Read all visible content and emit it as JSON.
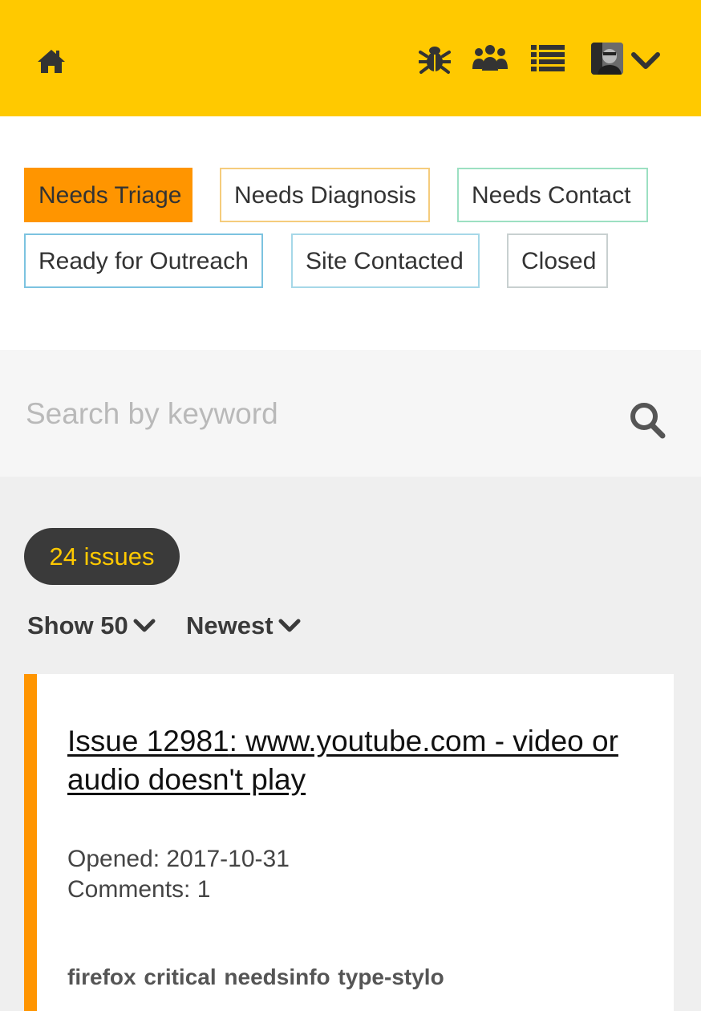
{
  "header": {
    "icons": [
      "home-icon",
      "bug-icon",
      "people-icon",
      "list-icon",
      "avatar",
      "chevron-down-icon"
    ],
    "background": "#ffc900"
  },
  "labels": [
    {
      "text": "Needs Triage",
      "color": "#ff9500",
      "active": true
    },
    {
      "text": "Needs Diagnosis",
      "color": "#f5cc7c"
    },
    {
      "text": "Needs Contact",
      "color": "#9ce0c2"
    },
    {
      "text": "Ready for Outreach",
      "color": "#7cc3e0"
    },
    {
      "text": "Site Contacted",
      "color": "#a6d8e8"
    },
    {
      "text": "Closed",
      "color": "#c8d0d0"
    }
  ],
  "search": {
    "placeholder": "Search by keyword",
    "value": ""
  },
  "results": {
    "count_label": "24 issues",
    "show_label": "Show 50",
    "sort_label": "Newest"
  },
  "issue": {
    "number_label": "Issue 12981",
    "title_rest": ": www.youtube.com - video or audio doesn't play",
    "opened": "Opened: 2017-10-31",
    "comments": "Comments: 1",
    "tags": "firefox critical needsinfo type-stylo",
    "accent": "#ff9500"
  }
}
